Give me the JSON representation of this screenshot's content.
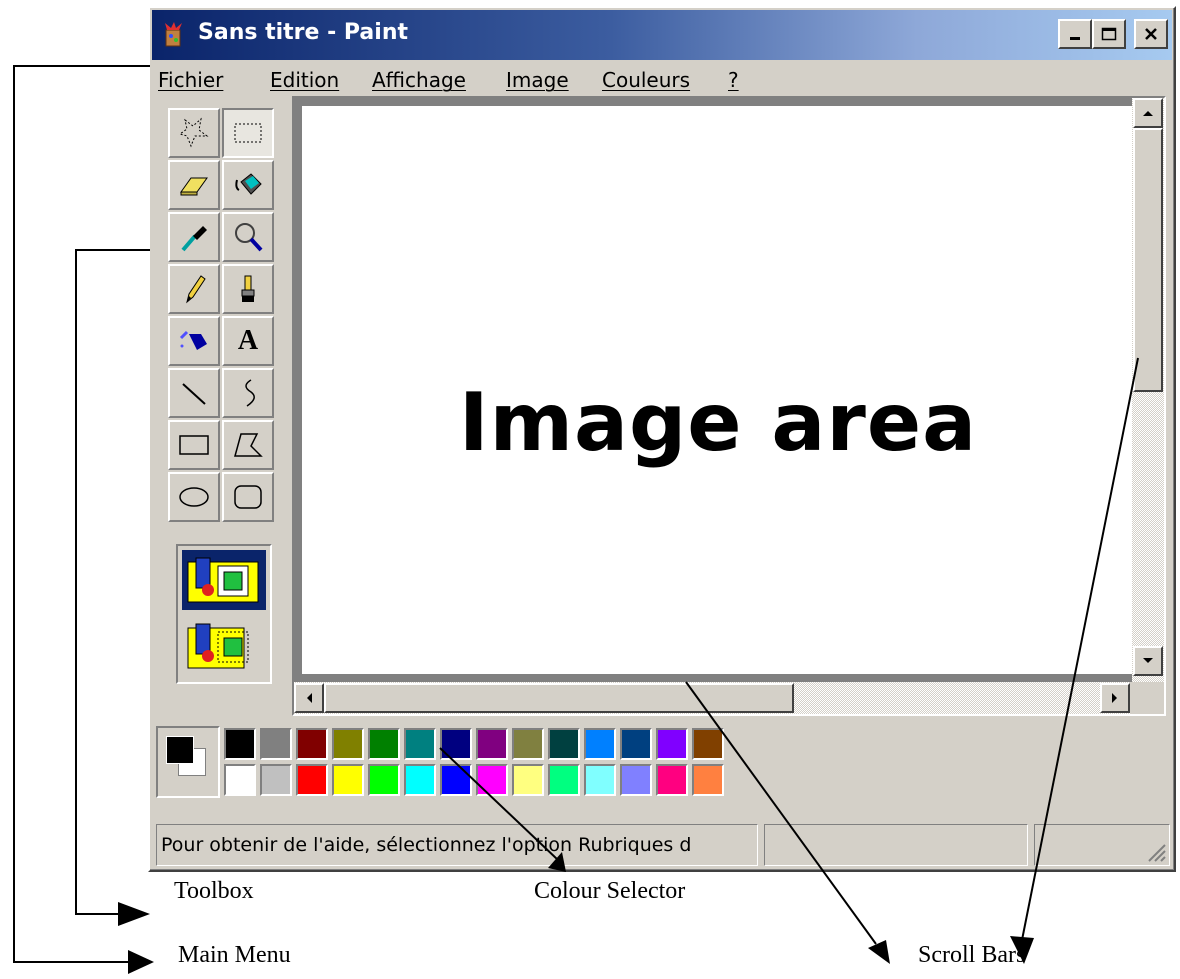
{
  "window": {
    "title": "Sans titre - Paint",
    "minimize_glyph": "_",
    "close_glyph": "×"
  },
  "menu": [
    {
      "label": "Fichier"
    },
    {
      "label": "Edition"
    },
    {
      "label": "Affichage"
    },
    {
      "label": "Image"
    },
    {
      "label": "Couleurs"
    },
    {
      "label": "?"
    }
  ],
  "toolbox": {
    "tools": [
      {
        "name": "free-form-select-icon"
      },
      {
        "name": "rect-select-icon"
      },
      {
        "name": "eraser-icon"
      },
      {
        "name": "fill-bucket-icon"
      },
      {
        "name": "color-picker-icon"
      },
      {
        "name": "magnifier-icon"
      },
      {
        "name": "pencil-icon"
      },
      {
        "name": "brush-icon"
      },
      {
        "name": "airbrush-icon"
      },
      {
        "name": "text-icon",
        "glyph": "A"
      },
      {
        "name": "line-icon"
      },
      {
        "name": "curve-icon"
      },
      {
        "name": "rectangle-icon"
      },
      {
        "name": "polygon-icon"
      },
      {
        "name": "ellipse-icon"
      },
      {
        "name": "rounded-rect-icon"
      }
    ]
  },
  "canvas": {
    "label": "Image area"
  },
  "palette": {
    "top_row": [
      "#000000",
      "#808080",
      "#800000",
      "#808000",
      "#008000",
      "#008080",
      "#000080",
      "#800080",
      "#808040",
      "#004040",
      "#0080ff",
      "#004080",
      "#8000ff",
      "#804000"
    ],
    "bottom_row": [
      "#ffffff",
      "#c0c0c0",
      "#ff0000",
      "#ffff00",
      "#00ff00",
      "#00ffff",
      "#0000ff",
      "#ff00ff",
      "#ffff80",
      "#00ff80",
      "#80ffff",
      "#8080ff",
      "#ff0080",
      "#ff8040"
    ],
    "foreground": "#000000",
    "background": "#ffffff"
  },
  "statusbar": {
    "help_text": "Pour obtenir de l'aide, sélectionnez l'option Rubriques d"
  },
  "annotations": {
    "toolbox": "Toolbox",
    "colour_selector": "Colour Selector",
    "main_menu": "Main Menu",
    "scroll_bars": "Scroll Bars"
  }
}
